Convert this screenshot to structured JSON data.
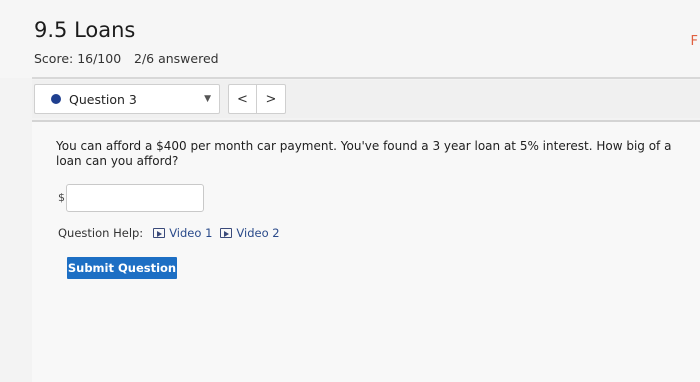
{
  "header": {
    "title": "9.5 Loans",
    "score": "Score: 16/100",
    "answered": "2/6 answered",
    "edge_letter": "F"
  },
  "question_nav": {
    "selected": "Question 3",
    "prev_label": "<",
    "next_label": ">"
  },
  "question": {
    "text": "You can afford a $400 per month car payment. You've found a 3 year loan at 5% interest. How big of a loan can you afford?",
    "currency_prefix": "$",
    "answer_value": ""
  },
  "help": {
    "label": "Question Help:",
    "links": [
      "Video 1",
      "Video 2"
    ]
  },
  "submit_label": "Submit Question",
  "colors": {
    "accent": "#1d6fc4",
    "question_dot": "#1f3f8f"
  }
}
